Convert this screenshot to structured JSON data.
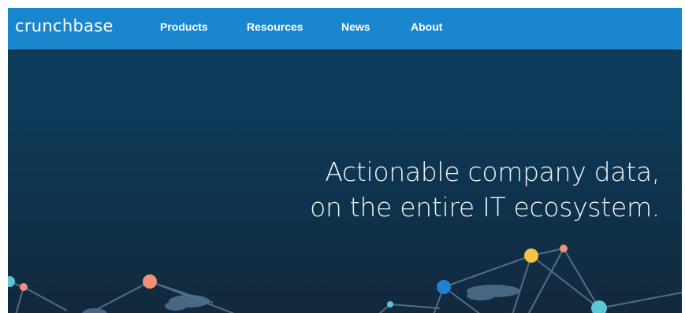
{
  "header": {
    "logo": "crunchbase",
    "nav": [
      {
        "label": "Products"
      },
      {
        "label": "Resources"
      },
      {
        "label": "News"
      },
      {
        "label": "About"
      }
    ]
  },
  "hero": {
    "line1": "Actionable company data,",
    "line2": "on the entire IT ecosystem."
  },
  "colors": {
    "nav_bar": "#1a86cd",
    "hero_background": "#0d3b58",
    "node_salmon": "#f2917a",
    "node_yellow": "#f6c445",
    "node_blue": "#1e82d2",
    "node_teal": "#5cc6d6"
  }
}
